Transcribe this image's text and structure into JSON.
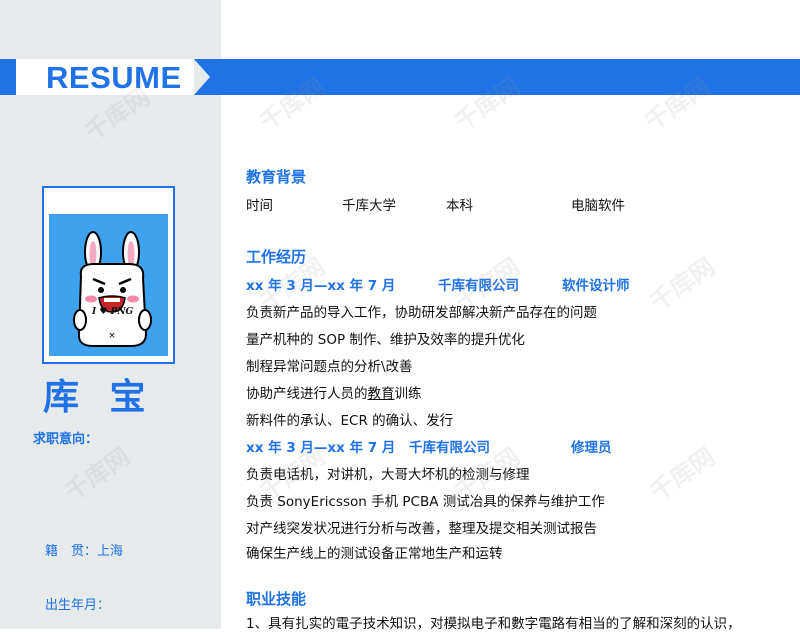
{
  "header": {
    "title": "RESUME"
  },
  "profile": {
    "name": "库 宝",
    "badge_text": "I ♥ PNG",
    "job_intent_label": "求职意向：",
    "hometown_label": "籍　贯：",
    "hometown_value": "上海",
    "birth_label": "出生年月："
  },
  "education": {
    "title": "教育背景",
    "time": "时间",
    "school": "千库大学",
    "degree": "本科",
    "major": "电脑软件"
  },
  "work": {
    "title": "工作经历",
    "jobs": [
      {
        "period": "xx 年 3 月—xx 年 7 月",
        "company": "千库有限公司",
        "position": "软件设计师",
        "duties": [
          "负责新产品的导入工作，协助研发部解决新产品存在的问题",
          "量产机种的 SOP 制作、维护及效率的提升优化",
          "制程异常问题点的分析\\改善",
          "协助产线进行人员的",
          "教育",
          "训练",
          "新料件的承认、ECR 的确认、发行"
        ]
      },
      {
        "period": "xx 年 3 月—xx 年 7 月",
        "company": "千库有限公司",
        "position": "修理员",
        "duties": [
          "负责电话机，对讲机，大哥大坏机的检测与修理",
          "负责 SonyEricsson 手机 PCBA 测试冶具的保养与维护工作",
          "对产线突发状况进行分析与改善，整理及提交相关测试报告",
          "确保生产线上的测试设备正常地生产和运转"
        ]
      }
    ]
  },
  "skills": {
    "title": "职业技能",
    "items": [
      "1、具有扎实的電子技术知识，对模拟电子和數字電路有相当的了解和深刻的认识，"
    ]
  },
  "colors": {
    "accent": "#1f73e6",
    "sidebar": "#e6eaeb",
    "photo_bg": "#3fa2ee"
  },
  "watermark": "千库网"
}
